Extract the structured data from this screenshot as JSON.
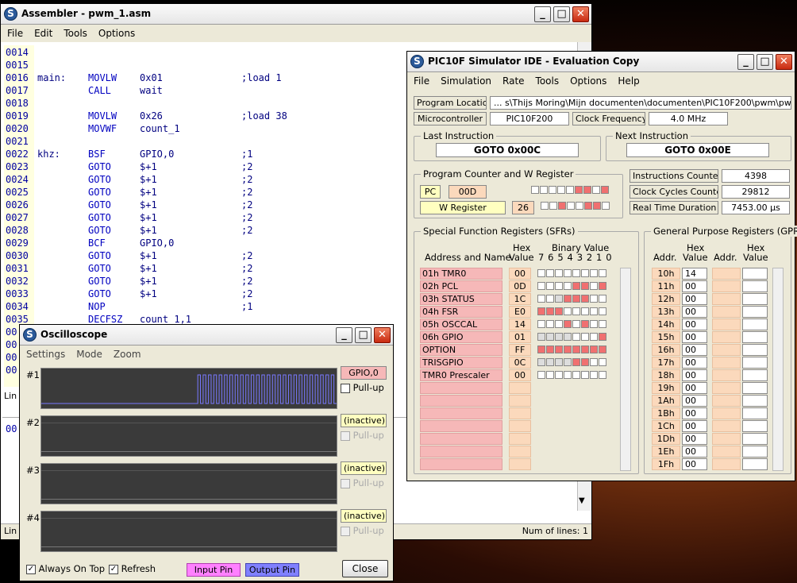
{
  "assembler": {
    "title": "Assembler - pwm_1.asm",
    "menu": [
      "File",
      "Edit",
      "Tools",
      "Options"
    ],
    "lines": [
      {
        "n": "0014",
        "label": "",
        "op": "",
        "arg": "",
        "cm": ""
      },
      {
        "n": "0015",
        "label": "",
        "op": "",
        "arg": "",
        "cm": ""
      },
      {
        "n": "0016",
        "label": "main:",
        "op": "MOVLW",
        "arg": "0x01",
        "cm": ";load 1"
      },
      {
        "n": "0017",
        "label": "",
        "op": "CALL",
        "arg": "wait",
        "cm": ""
      },
      {
        "n": "0018",
        "label": "",
        "op": "",
        "arg": "",
        "cm": ""
      },
      {
        "n": "0019",
        "label": "",
        "op": "MOVLW",
        "arg": "0x26",
        "cm": ";load 38"
      },
      {
        "n": "0020",
        "label": "",
        "op": "MOVWF",
        "arg": "count_1",
        "cm": ""
      },
      {
        "n": "0021",
        "label": "",
        "op": "",
        "arg": "",
        "cm": ""
      },
      {
        "n": "0022",
        "label": "khz:",
        "op": "BSF",
        "arg": "GPIO,0",
        "cm": ";1"
      },
      {
        "n": "0023",
        "label": "",
        "op": "GOTO",
        "arg": "$+1",
        "cm": ";2"
      },
      {
        "n": "0024",
        "label": "",
        "op": "GOTO",
        "arg": "$+1",
        "cm": ";2"
      },
      {
        "n": "0025",
        "label": "",
        "op": "GOTO",
        "arg": "$+1",
        "cm": ";2"
      },
      {
        "n": "0026",
        "label": "",
        "op": "GOTO",
        "arg": "$+1",
        "cm": ";2"
      },
      {
        "n": "0027",
        "label": "",
        "op": "GOTO",
        "arg": "$+1",
        "cm": ";2"
      },
      {
        "n": "0028",
        "label": "",
        "op": "GOTO",
        "arg": "$+1",
        "cm": ";2"
      },
      {
        "n": "0029",
        "label": "",
        "op": "BCF",
        "arg": "GPIO,0",
        "cm": ""
      },
      {
        "n": "0030",
        "label": "",
        "op": "GOTO",
        "arg": "$+1",
        "cm": ";2"
      },
      {
        "n": "0031",
        "label": "",
        "op": "GOTO",
        "arg": "$+1",
        "cm": ";2"
      },
      {
        "n": "0032",
        "label": "",
        "op": "GOTO",
        "arg": "$+1",
        "cm": ";2"
      },
      {
        "n": "0033",
        "label": "",
        "op": "GOTO",
        "arg": "$+1",
        "cm": ";2"
      },
      {
        "n": "0034",
        "label": "",
        "op": "NOP",
        "arg": "",
        "cm": ";1"
      },
      {
        "n": "0035",
        "label": "",
        "op": "DECFSZ",
        "arg": "count_1,1",
        "cm": ""
      },
      {
        "n": "00",
        "label": "",
        "op": "",
        "arg": "",
        "cm": ""
      },
      {
        "n": "00",
        "label": "",
        "op": "",
        "arg": "",
        "cm": ""
      },
      {
        "n": "00",
        "label": "",
        "op": "",
        "arg": "",
        "cm": ""
      },
      {
        "n": "00",
        "label": "",
        "op": "",
        "arg": "",
        "cm": ""
      }
    ],
    "status1": "Lin",
    "lower_line": "00",
    "status2": "Lin 1",
    "num_lines": "Num of lines: 1"
  },
  "sim": {
    "title": "PIC10F Simulator IDE - Evaluation Copy",
    "menu": [
      "File",
      "Simulation",
      "Rate",
      "Tools",
      "Options",
      "Help"
    ],
    "prog_loc_label": "Program Location",
    "prog_loc": "... s\\Thijs Moring\\Mijn documenten\\documenten\\PIC10F200\\pwm\\pwm_1.hex",
    "mc_label": "Microcontroller",
    "mc": "PIC10F200",
    "cf_label": "Clock Frequency",
    "cf": "4.0 MHz",
    "last_label": "Last Instruction",
    "last": "GOTO 0x00C",
    "next_label": "Next Instruction",
    "next": "GOTO 0x00E",
    "pcw_label": "Program Counter and W Register",
    "pc_label": "PC",
    "pc": "00D",
    "w_label": "W Register",
    "w": "26",
    "pc_bits": [
      0,
      0,
      0,
      0,
      0,
      1,
      1,
      0,
      1
    ],
    "w_bits": [
      0,
      0,
      1,
      0,
      0,
      1,
      1,
      0
    ],
    "ic_label": "Instructions Counter",
    "ic": "4398",
    "cc_label": "Clock Cycles Counter",
    "cc": "29812",
    "rt_label": "Real Time Duration",
    "rt": "7453.00 µs",
    "sfr_label": "Special Function Registers (SFRs)",
    "sfr_addr_hdr": "Address and Name",
    "hex_hdr1": "Hex",
    "hex_hdr2": "Value",
    "bin_hdr": "Binary Value",
    "bit_nums": "7 6 5 4 3 2 1 0",
    "sfr": [
      {
        "name": "01h  TMR0",
        "hex": "00",
        "bits": [
          0,
          0,
          0,
          0,
          0,
          0,
          0,
          0
        ]
      },
      {
        "name": "02h  PCL",
        "hex": "0D",
        "bits": [
          0,
          0,
          0,
          0,
          1,
          1,
          0,
          1
        ]
      },
      {
        "name": "03h  STATUS",
        "hex": "1C",
        "bits": [
          0,
          0,
          2,
          1,
          1,
          1,
          0,
          0
        ]
      },
      {
        "name": "04h  FSR",
        "hex": "E0",
        "bits": [
          1,
          1,
          1,
          0,
          0,
          0,
          0,
          0
        ]
      },
      {
        "name": "05h  OSCCAL",
        "hex": "14",
        "bits": [
          0,
          0,
          0,
          1,
          0,
          1,
          0,
          0
        ]
      },
      {
        "name": "06h  GPIO",
        "hex": "01",
        "bits": [
          2,
          2,
          2,
          2,
          0,
          0,
          0,
          1
        ]
      },
      {
        "name": "OPTION",
        "hex": "FF",
        "bits": [
          1,
          1,
          1,
          1,
          1,
          1,
          1,
          1
        ]
      },
      {
        "name": "TRISGPIO",
        "hex": "0C",
        "bits": [
          2,
          2,
          2,
          2,
          1,
          1,
          0,
          0
        ]
      },
      {
        "name": "TMR0 Prescaler",
        "hex": "00",
        "bits": [
          0,
          0,
          0,
          0,
          0,
          0,
          0,
          0
        ]
      }
    ],
    "gpr_label": "General Purpose Registers (GPRs)",
    "gpr_addr_hdr": "Addr.",
    "gpr_hex_hdr1": "Hex",
    "gpr_hex_hdr2": "Value",
    "gpr": [
      {
        "a": "10h",
        "v": "14"
      },
      {
        "a": "11h",
        "v": "00"
      },
      {
        "a": "12h",
        "v": "00"
      },
      {
        "a": "13h",
        "v": "00"
      },
      {
        "a": "14h",
        "v": "00"
      },
      {
        "a": "15h",
        "v": "00"
      },
      {
        "a": "16h",
        "v": "00"
      },
      {
        "a": "17h",
        "v": "00"
      },
      {
        "a": "18h",
        "v": "00"
      },
      {
        "a": "19h",
        "v": "00"
      },
      {
        "a": "1Ah",
        "v": "00"
      },
      {
        "a": "1Bh",
        "v": "00"
      },
      {
        "a": "1Ch",
        "v": "00"
      },
      {
        "a": "1Dh",
        "v": "00"
      },
      {
        "a": "1Eh",
        "v": "00"
      },
      {
        "a": "1Fh",
        "v": "00"
      }
    ]
  },
  "osc": {
    "title": "Oscilloscope",
    "menu": [
      "Settings",
      "Mode",
      "Zoom"
    ],
    "channels": [
      {
        "num": "#1",
        "pin": "GPIO,0",
        "pullup": "Pull-up",
        "active": true
      },
      {
        "num": "#2",
        "pin": "(inactive)",
        "pullup": "Pull-up",
        "active": false
      },
      {
        "num": "#3",
        "pin": "(inactive)",
        "pullup": "Pull-up",
        "active": false
      },
      {
        "num": "#4",
        "pin": "(inactive)",
        "pullup": "Pull-up",
        "active": false
      }
    ],
    "always_on_top": "Always On Top",
    "refresh": "Refresh",
    "input_pin": "Input Pin",
    "output_pin": "Output Pin",
    "close": "Close",
    "pulses": {
      "start_fraction": 0.53,
      "count": 26
    }
  },
  "colors": {
    "sfr_name_bg": "#f6b8b8",
    "hex_bg": "#fbd9bc",
    "yellow": "#ffffc0",
    "bit_on": "#f07070",
    "scope_bg": "#3a3a3a",
    "trace": "#7878ff",
    "input_pin": "#ff80ff",
    "output_pin": "#8080ff"
  }
}
